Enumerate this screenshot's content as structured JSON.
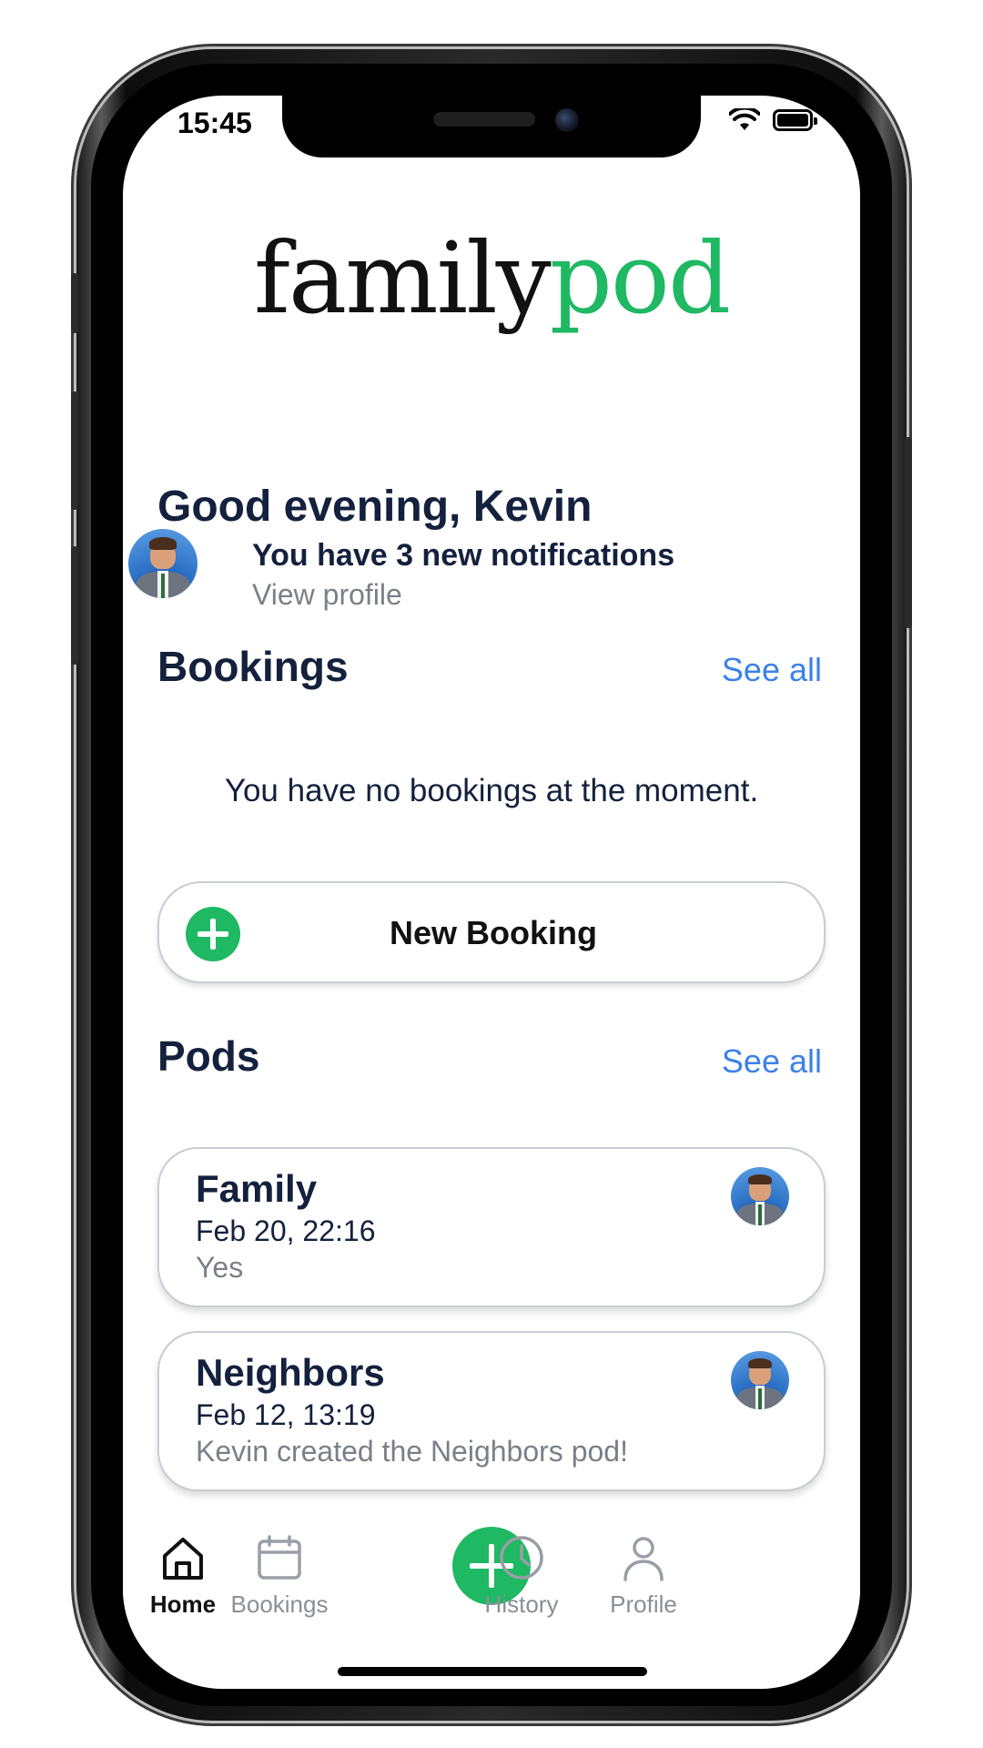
{
  "status_bar": {
    "time": "15:45"
  },
  "logo": {
    "part1": "family",
    "part2": "pod"
  },
  "greeting": {
    "title": "Good evening, Kevin",
    "notifications": "You have 3 new notifications",
    "view_profile": "View profile"
  },
  "bookings": {
    "title": "Bookings",
    "see_all": "See all",
    "empty_message": "You have no bookings at the moment.",
    "new_booking_label": "New Booking"
  },
  "pods": {
    "title": "Pods",
    "see_all": "See all",
    "items": [
      {
        "name": "Family",
        "date": "Feb 20, 22:16",
        "message": "Yes"
      },
      {
        "name": "Neighbors",
        "date": "Feb 12, 13:19",
        "message": "Kevin created the Neighbors  pod!"
      }
    ]
  },
  "tabbar": {
    "items": [
      {
        "label": "Home",
        "icon": "home-icon",
        "active": true
      },
      {
        "label": "Bookings",
        "icon": "calendar-icon",
        "active": false
      },
      {
        "label": "",
        "icon": "plus-icon",
        "active": false
      },
      {
        "label": "History",
        "icon": "clock-icon",
        "active": false
      },
      {
        "label": "Profile",
        "icon": "person-icon",
        "active": false
      }
    ]
  },
  "colors": {
    "brand_green": "#1fb863",
    "link_blue": "#3b82e6",
    "navy_text": "#14213d",
    "muted_text": "#7b7f87"
  }
}
